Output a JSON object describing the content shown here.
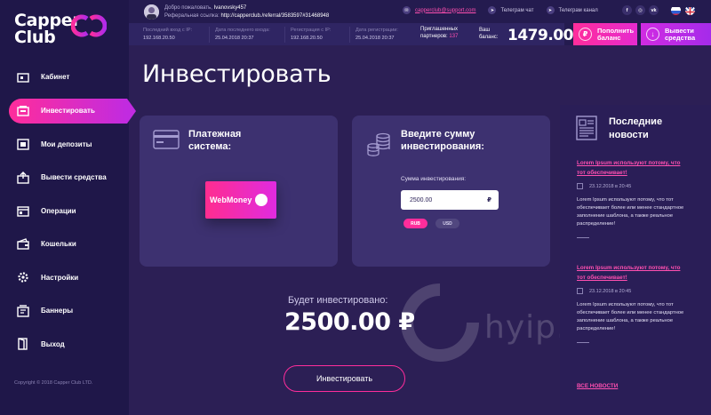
{
  "brand": {
    "line1": "Capper",
    "line2": "Club"
  },
  "sidebar": {
    "items": [
      {
        "label": "Кабинет",
        "icon": "cabinet-icon"
      },
      {
        "label": "Инвестировать",
        "icon": "invest-icon",
        "active": true
      },
      {
        "label": "Мои депозиты",
        "icon": "deposits-icon"
      },
      {
        "label": "Вывести средства",
        "icon": "withdraw-icon"
      },
      {
        "label": "Операции",
        "icon": "operations-icon"
      },
      {
        "label": "Кошельки",
        "icon": "wallets-icon"
      },
      {
        "label": "Настройки",
        "icon": "settings-icon"
      },
      {
        "label": "Баннеры",
        "icon": "banners-icon"
      },
      {
        "label": "Выход",
        "icon": "exit-icon"
      }
    ],
    "copyright": "Copyright © 2018 Capper Club LTD."
  },
  "topbar": {
    "welcome_label": "Добро пожаловать,",
    "username": "Ivanovsky457",
    "referral_label": "Реферальная ссылка:",
    "referral_link": "http://capperclub./referral/3583597#31468948",
    "email": "capperclub@support.com",
    "telegram_chat": "Телеграм чат",
    "telegram_channel": "Телеграм канал",
    "social": [
      "f",
      "ig",
      "vk"
    ],
    "languages": [
      "ru",
      "en"
    ]
  },
  "stats": {
    "last_ip_label": "Последний вход с IP:",
    "last_ip": "192.168.20.50",
    "last_date_label": "Дата последнего входа:",
    "last_date": "25.04.2018  20:37",
    "reg_ip_label": "Регистрация с IP:",
    "reg_ip": "192.168.20.50",
    "reg_date_label": "Дата регистрации:",
    "reg_date": "25.04.2018  20:37",
    "invited_label_1": "Приглашенных",
    "invited_label_2": "партнеров:",
    "invited_count": "137",
    "balance_label_1": "Ваш",
    "balance_label_2": "баланс:",
    "balance": "1479.00$"
  },
  "actions": {
    "deposit_1": "Пополнить",
    "deposit_2": "баланс",
    "withdraw_1": "Вывести",
    "withdraw_2": "средства"
  },
  "main": {
    "title": "Инвестировать",
    "payment_title_1": "Платежная",
    "payment_title_2": "система:",
    "payment_method": "WebMoney",
    "amount_title_1": "Введите сумму",
    "amount_title_2": "инвестирования:",
    "amount_label": "Сумма инвестирования:",
    "amount_value": "2500.00",
    "amount_currency_symbol": "₽",
    "currency_options": [
      "RUB",
      "USD"
    ],
    "selected_currency": "RUB",
    "will_invest_label": "Будет инвестировано:",
    "will_invest_amount": "2500.00 ₽",
    "invest_button": "Инвестировать",
    "watermark": "hyip."
  },
  "news": {
    "title_1": "Последние",
    "title_2": "новости",
    "items": [
      {
        "headline_1": "Lorem Ipsum используют потому, что",
        "headline_2": "тот обеспечивает!",
        "date": "23.12.2018 в 20:45",
        "text": "Lorem Ipsum используют потому, что тот обеспечивает более или менее стандартное заполнение шаблона, а также реальное распределение!"
      },
      {
        "headline_1": "Lorem Ipsum используют потому, что",
        "headline_2": "тот обеспечивает!",
        "date": "23.12.2018 в 20:45",
        "text": "Lorem Ipsum используют потому, что тот обеспечивает более или менее стандартное заполнение шаблона, а также реальное распределение!"
      }
    ],
    "all_news": "ВСЕ НОВОСТИ"
  }
}
